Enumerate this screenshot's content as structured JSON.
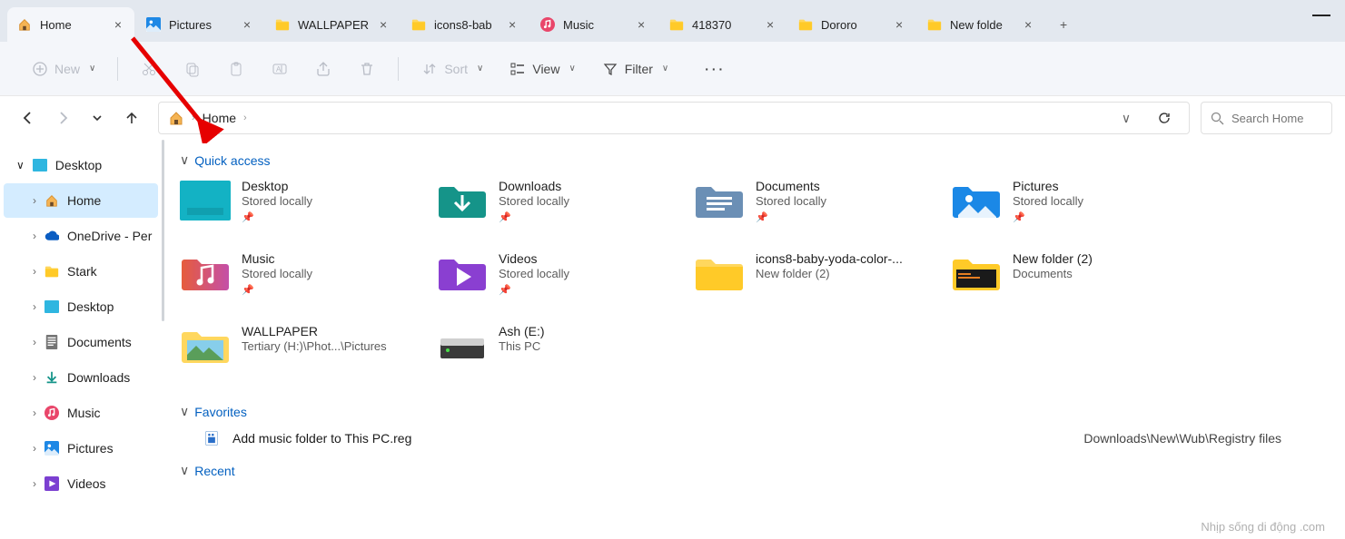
{
  "tabs": [
    {
      "label": "Home",
      "icon": "home",
      "active": true
    },
    {
      "label": "Pictures",
      "icon": "picture"
    },
    {
      "label": "WALLPAPER",
      "icon": "folder"
    },
    {
      "label": "icons8-bab",
      "icon": "folder"
    },
    {
      "label": "Music",
      "icon": "music"
    },
    {
      "label": "418370",
      "icon": "folder"
    },
    {
      "label": "Dororo",
      "icon": "folder"
    },
    {
      "label": "New folde",
      "icon": "folder"
    }
  ],
  "toolbar": {
    "new": "New",
    "sort": "Sort",
    "view": "View",
    "filter": "Filter"
  },
  "breadcrumb": {
    "seg": "Home"
  },
  "search": {
    "placeholder": "Search Home"
  },
  "sidebar": {
    "root": "Desktop",
    "items": [
      {
        "label": "Home",
        "icon": "home",
        "sel": true
      },
      {
        "label": "OneDrive - Per",
        "icon": "cloud"
      },
      {
        "label": "Stark",
        "icon": "folder"
      },
      {
        "label": "Desktop",
        "icon": "desktop"
      },
      {
        "label": "Documents",
        "icon": "doc"
      },
      {
        "label": "Downloads",
        "icon": "down"
      },
      {
        "label": "Music",
        "icon": "music"
      },
      {
        "label": "Pictures",
        "icon": "picture"
      },
      {
        "label": "Videos",
        "icon": "video"
      }
    ]
  },
  "sections": {
    "quick": "Quick access",
    "favorites": "Favorites",
    "recent": "Recent"
  },
  "quick": [
    {
      "name": "Desktop",
      "sub": "Stored locally",
      "pin": true,
      "icon": "desktop-lg"
    },
    {
      "name": "Downloads",
      "sub": "Stored locally",
      "pin": true,
      "icon": "down-lg"
    },
    {
      "name": "Documents",
      "sub": "Stored locally",
      "pin": true,
      "icon": "doc-lg"
    },
    {
      "name": "Pictures",
      "sub": "Stored locally",
      "pin": true,
      "icon": "pic-lg"
    },
    {
      "name": "Music",
      "sub": "Stored locally",
      "pin": true,
      "icon": "mus-lg"
    },
    {
      "name": "Videos",
      "sub": "Stored locally",
      "pin": true,
      "icon": "vid-lg"
    },
    {
      "name": "icons8-baby-yoda-color-...",
      "sub": "New folder (2)",
      "icon": "folder-lg"
    },
    {
      "name": "New folder (2)",
      "sub": "Documents",
      "icon": "blk-lg"
    },
    {
      "name": "WALLPAPER",
      "sub": "Tertiary (H:)\\Phot...\\Pictures",
      "icon": "folder-pic"
    },
    {
      "name": "Ash (E:)",
      "sub": "This PC",
      "icon": "drive"
    }
  ],
  "fav": {
    "name": "Add music folder to This PC.reg",
    "path": "Downloads\\New\\Wub\\Registry files"
  },
  "watermark": "Nhịp sống di động .com"
}
